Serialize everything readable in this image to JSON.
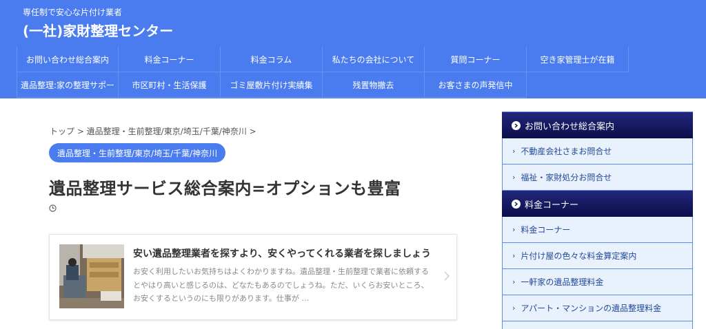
{
  "header": {
    "tagline": "専任制で安心な片付け業者",
    "site_title": "(一社)家財整理センター"
  },
  "nav": {
    "row1": [
      "お問い合わせ総合案内",
      "料金コーナー",
      "料金コラム",
      "私たちの会社について",
      "質問コーナー",
      "空き家管理士が在籍"
    ],
    "row2": [
      "遺品整理:家の整理サポー",
      "市区町村・生活保護",
      "ゴミ屋敷片付け実績集",
      "残置物撤去",
      "お客さまの声発信中"
    ]
  },
  "breadcrumb": {
    "text": "トップ > 遺品整理・生前整理/東京/埼玉/千葉/神奈川 >"
  },
  "category_label": "遺品整理・生前整理/東京/埼玉/千葉/神奈川",
  "page_title": "遺品整理サービス総合案内=オプションも豊富",
  "card": {
    "title": "安い遺品整理業者を探すより、安くやってくれる業者を探しましょう",
    "excerpt_lines": [
      "お安く利用したいお気持ちはよくわかりますね。遺品整理・生前整理で業者に依頼する",
      "とやはり高いと感じるのは、どなたもあるのでしょうね。ただ、いくらお安いところ、",
      "お安くするというのにも限りがあります。仕事が …"
    ]
  },
  "sidebar": {
    "widget1": {
      "title": "お問い合わせ総合案内",
      "links": [
        "不動産会社さまお問合せ",
        "福祉・家財処分お問合せ"
      ]
    },
    "widget2": {
      "title": "料金コーナー",
      "links": [
        "料金コーナー",
        "片付け屋の色々な料金算定案内",
        "一軒家の遺品整理料金",
        "アパート・マンションの遺品整理料金"
      ]
    }
  },
  "colors": {
    "brand_blue": "#4a7cf0",
    "sidebar_head": "#0a0e4a",
    "sidebar_bg": "#e9f1fd",
    "sidebar_link": "#234b9a"
  },
  "icons": {
    "clock": "clock-icon",
    "chevron": "chevron-right-icon",
    "widget_head": "chevron-circle-right-icon"
  }
}
